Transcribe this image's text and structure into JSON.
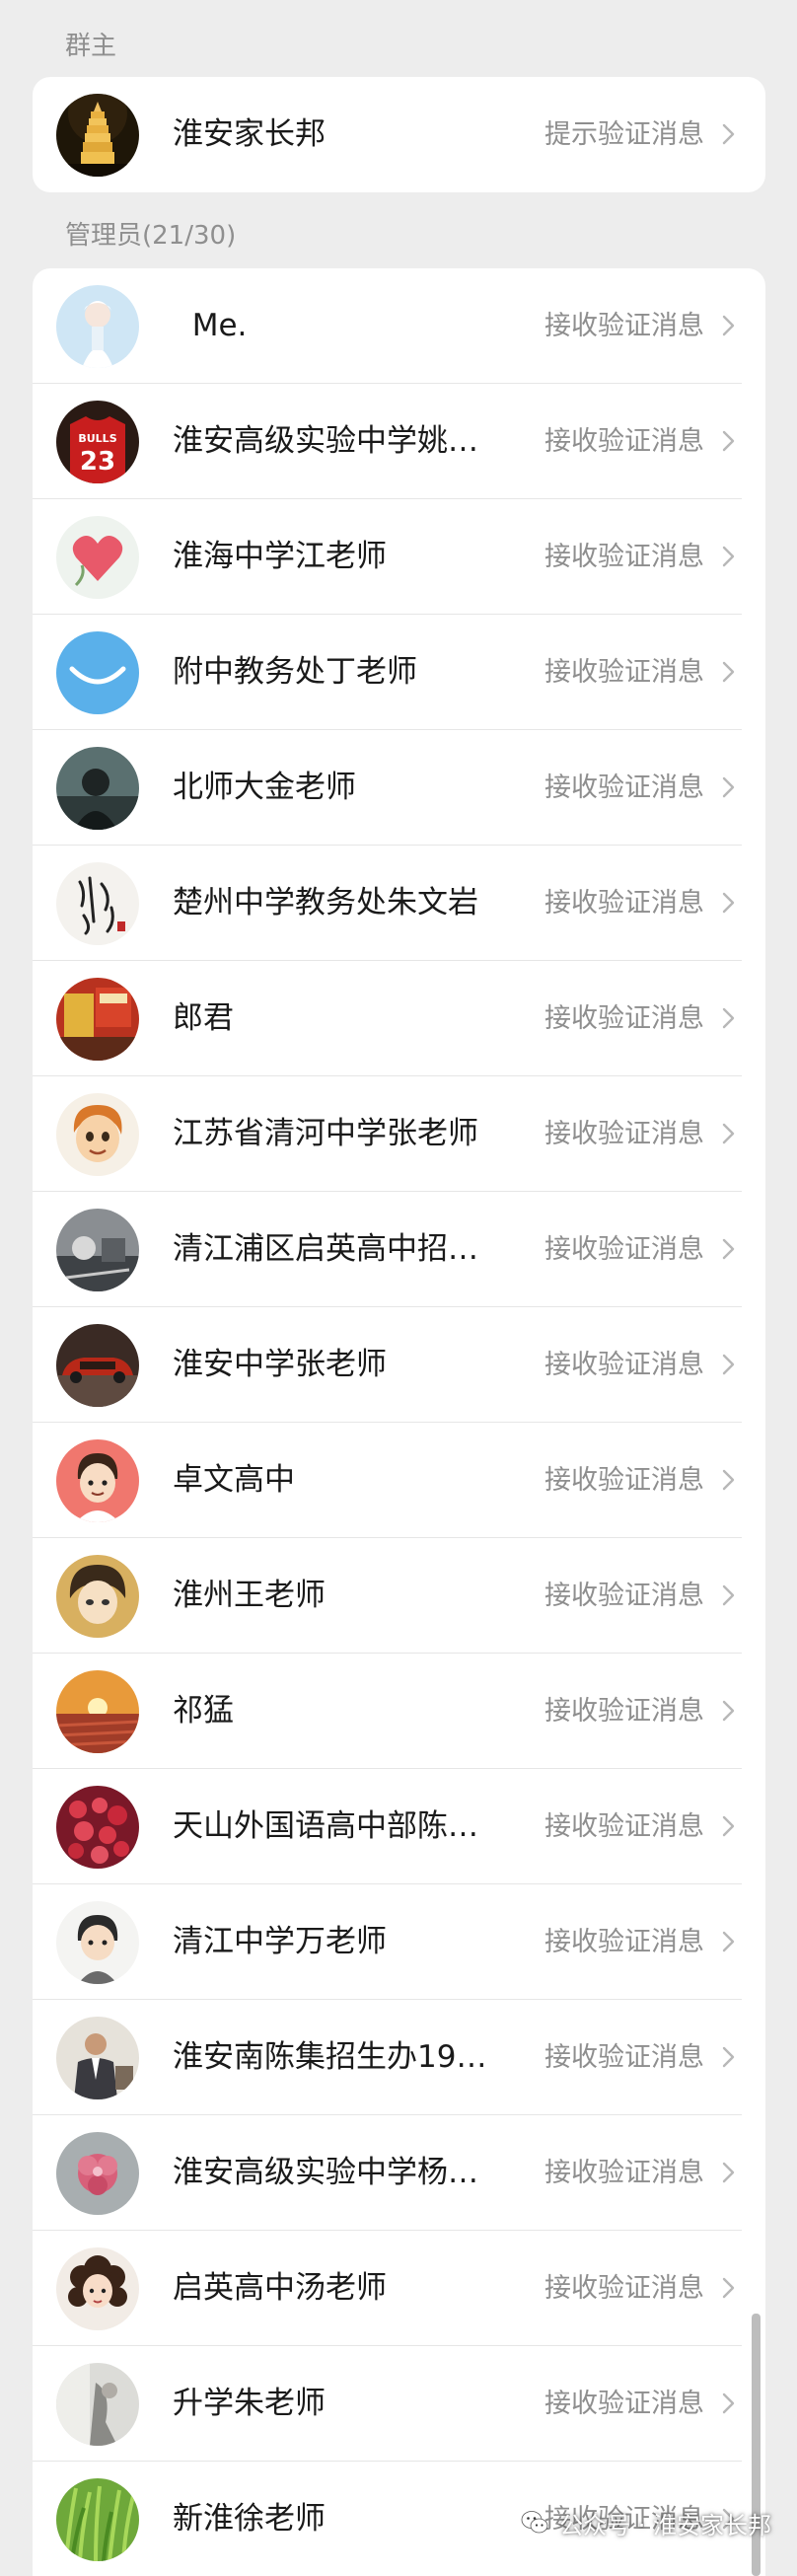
{
  "owner_section": {
    "header": "群主",
    "members": [
      {
        "name": "淮安家长邦",
        "status": "提示验证消息",
        "avatar": "pagoda-night"
      }
    ]
  },
  "admin_section": {
    "header": "管理员(21/30)",
    "members": [
      {
        "name": "  Me.",
        "status": "接收验证消息",
        "avatar": "girl-sky"
      },
      {
        "name": "淮安高级实验中学姚…",
        "status": "接收验证消息",
        "avatar": "jersey-23"
      },
      {
        "name": "淮海中学江老师",
        "status": "接收验证消息",
        "avatar": "pink-heart"
      },
      {
        "name": "附中教务处丁老师",
        "status": "接收验证消息",
        "avatar": "blue-smile"
      },
      {
        "name": "北师大金老师",
        "status": "接收验证消息",
        "avatar": "dark-portrait"
      },
      {
        "name": "楚州中学教务处朱文岩",
        "status": "接收验证消息",
        "avatar": "calligraphy"
      },
      {
        "name": "郎君",
        "status": "接收验证消息",
        "avatar": "snack-red"
      },
      {
        "name": "江苏省清河中学张老师",
        "status": "接收验证消息",
        "avatar": "cartoon-boy"
      },
      {
        "name": "清江浦区启英高中招…",
        "status": "接收验证消息",
        "avatar": "grey-scene"
      },
      {
        "name": "淮安中学张老师",
        "status": "接收验证消息",
        "avatar": "red-car"
      },
      {
        "name": "卓文高中",
        "status": "接收验证消息",
        "avatar": "chibi-pink"
      },
      {
        "name": "淮州王老师",
        "status": "接收验证消息",
        "avatar": "anime-gold"
      },
      {
        "name": "祁猛",
        "status": "接收验证消息",
        "avatar": "sunset-field"
      },
      {
        "name": "天山外国语高中部陈…",
        "status": "接收验证消息",
        "avatar": "red-flowers"
      },
      {
        "name": "清江中学万老师",
        "status": "接收验证消息",
        "avatar": "chibi-grey"
      },
      {
        "name": "淮安南陈集招生办19…",
        "status": "接收验证消息",
        "avatar": "man-suit"
      },
      {
        "name": "淮安高级实验中学杨…",
        "status": "接收验证消息",
        "avatar": "pink-flower"
      },
      {
        "name": "启英高中汤老师",
        "status": "接收验证消息",
        "avatar": "curly-girl"
      },
      {
        "name": "升学朱老师",
        "status": "接收验证消息",
        "avatar": "light-sketch"
      },
      {
        "name": "新淮徐老师",
        "status": "接收验证消息",
        "avatar": "green-grass"
      }
    ]
  },
  "watermark": {
    "text": "公众号 · 淮安家长邦",
    "icon": "wechat-icon"
  },
  "colors": {
    "background": "#ededed",
    "card": "#ffffff",
    "primary_text": "#1a1a1a",
    "secondary_text": "#8e8e8e"
  }
}
